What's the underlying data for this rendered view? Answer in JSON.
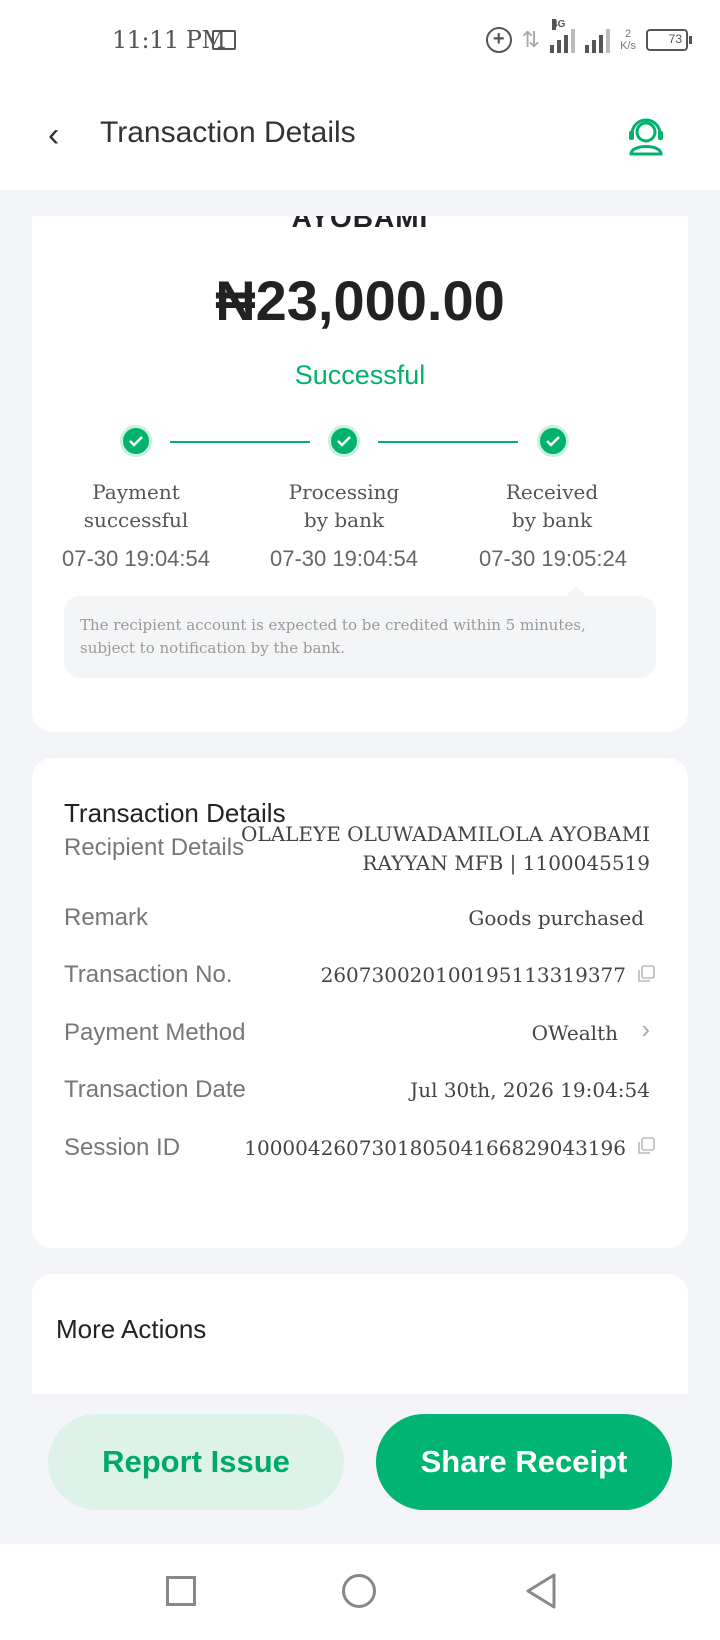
{
  "status_bar": {
    "time": "11:11 PM",
    "network": "4G",
    "speed_value": "2",
    "speed_unit": "K/s",
    "battery": "73"
  },
  "header": {
    "title": "Transaction Details",
    "back_icon": "chevron-left-icon",
    "support_icon": "headset-support-icon"
  },
  "summary": {
    "name_partial": "AYOBAMI",
    "amount": "₦23,000.00",
    "status": "Successful",
    "accent_color": "#00b26e",
    "steps": [
      {
        "label_line1": "Payment",
        "label_line2": "successful",
        "time": "07-30 19:04:54"
      },
      {
        "label_line1": "Processing",
        "label_line2": "by bank",
        "time": "07-30 19:04:54"
      },
      {
        "label_line1": "Received",
        "label_line2": "by bank",
        "time": "07-30 19:05:24"
      }
    ],
    "note": "The recipient account is expected to be credited within 5 minutes, subject to notification by the bank."
  },
  "details": {
    "title": "Transaction Details",
    "recipient_label": "Recipient Details",
    "recipient_line1": "OLALEYE OLUWADAMILOLA AYOBAMI",
    "recipient_line2": "RAYYAN MFB | 1100045519",
    "remark_label": "Remark",
    "remark_value": "Goods purchased",
    "txn_no_label": "Transaction No.",
    "txn_no_value": "260730020100195113319377",
    "method_label": "Payment Method",
    "method_value": "OWealth",
    "date_label": "Transaction Date",
    "date_value": "Jul 30th, 2026 19:04:54",
    "session_label": "Session ID",
    "session_value": "100004260730180504166829043196"
  },
  "more": {
    "title": "More Actions"
  },
  "actions": {
    "report": "Report Issue",
    "share": "Share Receipt"
  }
}
